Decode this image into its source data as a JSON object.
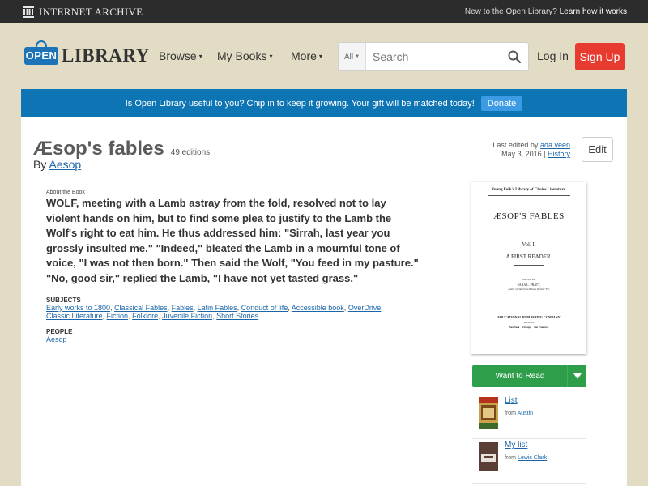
{
  "topbar": {
    "archive_name": "INTERNET ARCHIVE",
    "promo_text": "New to the Open Library?",
    "promo_link": "Learn how it works"
  },
  "header": {
    "logo_badge": "OPEN",
    "logo_word": "LIBRARY",
    "nav": [
      {
        "label": "Browse"
      },
      {
        "label": "My Books"
      },
      {
        "label": "More"
      }
    ],
    "search_scope": "All",
    "search_placeholder": "Search",
    "login_label": "Log In",
    "signup_label": "Sign Up"
  },
  "banner": {
    "text": "Is Open Library useful to you? Chip in to keep it growing. Your gift will be matched today!",
    "button": "Donate"
  },
  "book": {
    "title": "Æsop's fables",
    "editions": "49 editions",
    "by_prefix": "By",
    "author": "Aesop",
    "last_edited_prefix": "Last edited by",
    "last_edited_user": "ada veen",
    "last_edited_date": "May 3, 2016",
    "history_link": "History",
    "edit_button": "Edit",
    "about_label": "About the Book",
    "about_text": "WOLF, meeting with a Lamb astray from the fold, resolved not to lay violent hands on him, but to find some plea to justify to the Lamb the Wolf's right to eat him. He thus addressed him: \"Sirrah, last year you grossly insulted me.\" \"Indeed,\" bleated the Lamb in a mournful tone of voice, \"I was not then born.\" Then said the Wolf, \"You feed in my pasture.\" \"No, good sir,\" replied the Lamb, \"I have not yet tasted grass.\"",
    "subjects_label": "SUBJECTS",
    "subjects": [
      "Early works to 1800",
      "Classical Fables",
      "Fables",
      "Latin Fables",
      "Conduct of life",
      "Accessible book",
      "OverDrive",
      "Classic Literature",
      "Fiction",
      "Folklore",
      "Juvenile Fiction",
      "Short Stories"
    ],
    "people_label": "PEOPLE",
    "people": [
      "Aesop"
    ]
  },
  "cover": {
    "series": "Young Folk's Library of Choice Literature.",
    "title": "ÆSOP'S FABLES",
    "volume": "Vol. I.",
    "reader": "A FIRST READER.",
    "edited_by": "EDITED BY",
    "editor": "SARA L. PRATT,",
    "editor_note": "Author of \"American History Stories,\" Etc.",
    "publisher": "EDUCATIONAL PUBLISHING COMPANY",
    "city": "BOSTON",
    "cities": "New York     Chicago     San Francisco"
  },
  "sidebar": {
    "want_to_read": "Want to Read",
    "lists": [
      {
        "name": "List",
        "from_prefix": "from",
        "user": "Austin"
      },
      {
        "name": "My list",
        "from_prefix": "from",
        "user": "Lewis Clark"
      }
    ]
  }
}
